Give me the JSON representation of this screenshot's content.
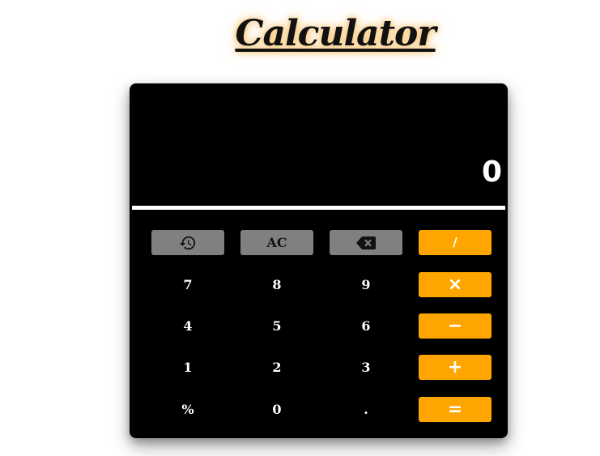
{
  "page": {
    "title": "Calculator"
  },
  "display": {
    "value": "0"
  },
  "keys": {
    "row1": [
      {
        "label": "",
        "icon": "history-icon",
        "kind": "gray"
      },
      {
        "label": "AC",
        "kind": "gray"
      },
      {
        "label": "",
        "icon": "backspace-icon",
        "kind": "gray"
      },
      {
        "label": "/",
        "kind": "orange"
      }
    ],
    "row2": [
      {
        "label": "7",
        "kind": "digit"
      },
      {
        "label": "8",
        "kind": "digit"
      },
      {
        "label": "9",
        "kind": "digit"
      },
      {
        "label": "×",
        "kind": "orange"
      }
    ],
    "row3": [
      {
        "label": "4",
        "kind": "digit"
      },
      {
        "label": "5",
        "kind": "digit"
      },
      {
        "label": "6",
        "kind": "digit"
      },
      {
        "label": "−",
        "kind": "orange"
      }
    ],
    "row4": [
      {
        "label": "1",
        "kind": "digit"
      },
      {
        "label": "2",
        "kind": "digit"
      },
      {
        "label": "3",
        "kind": "digit"
      },
      {
        "label": "+",
        "kind": "orange"
      }
    ],
    "row5": [
      {
        "label": "%",
        "kind": "digit"
      },
      {
        "label": "0",
        "kind": "digit"
      },
      {
        "label": ".",
        "kind": "digit"
      },
      {
        "label": "=",
        "kind": "orange"
      }
    ]
  },
  "colors": {
    "panel": "#000000",
    "operator": "#ffa500",
    "function": "#808080",
    "text": "#ffffff"
  }
}
